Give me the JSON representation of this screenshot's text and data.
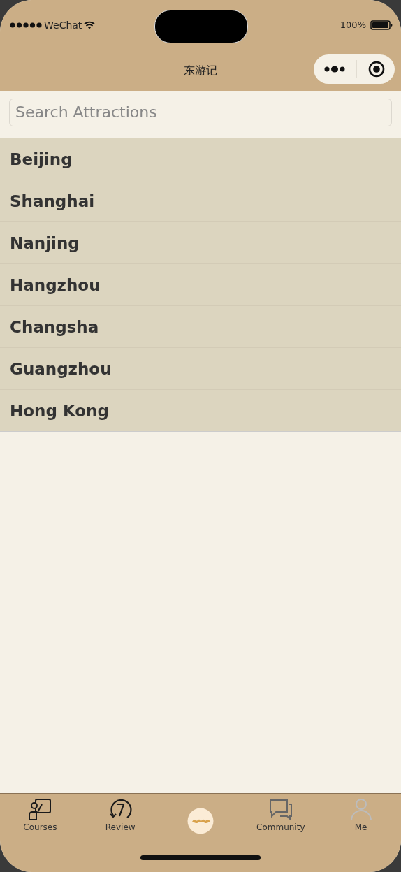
{
  "status_bar": {
    "carrier": "WeChat",
    "battery": "100%"
  },
  "nav_bar": {
    "title": "东游记"
  },
  "search": {
    "placeholder": "Search Attractions"
  },
  "cities": [
    {
      "name": "Beijing"
    },
    {
      "name": "Shanghai"
    },
    {
      "name": "Nanjing"
    },
    {
      "name": "Hangzhou"
    },
    {
      "name": "Changsha"
    },
    {
      "name": "Guangzhou"
    },
    {
      "name": "Hong Kong"
    }
  ],
  "tab_bar": [
    {
      "label": "Courses",
      "kind": "courses"
    },
    {
      "label": "Review",
      "kind": "review"
    },
    {
      "kind": "logo"
    },
    {
      "label": "Community",
      "kind": "community"
    },
    {
      "label": "Me",
      "kind": "me"
    }
  ]
}
